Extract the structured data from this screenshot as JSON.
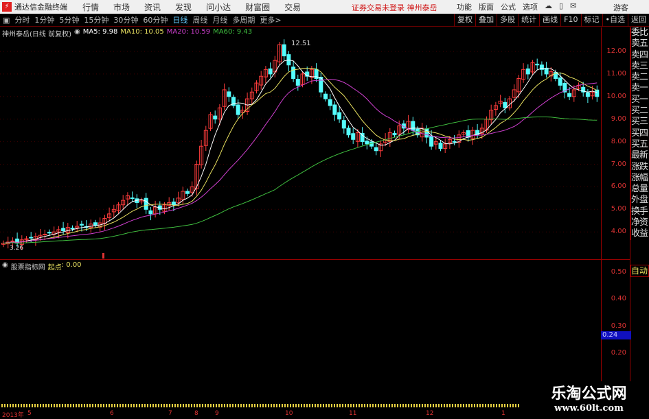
{
  "menubar": {
    "app_title": "通达信金融终端",
    "items": [
      "行情",
      "市场",
      "资讯",
      "发现",
      "问小达",
      "财富圈",
      "交易"
    ],
    "status": "证券交易未登录  神州泰岳",
    "right_items": [
      "功能",
      "版面",
      "公式",
      "选项"
    ],
    "guest": "游客"
  },
  "toolbar": {
    "periods": [
      "分时",
      "1分钟",
      "5分钟",
      "15分钟",
      "30分钟",
      "60分钟",
      "日线",
      "周线",
      "月线",
      "多周期",
      "更多>"
    ],
    "active": "日线",
    "right_buttons": [
      "复权",
      "叠加",
      "多股",
      "统计",
      "画线",
      "F10",
      "标记",
      "•自选",
      "返回"
    ]
  },
  "chart_info": {
    "title": "神州泰岳(日线 前复权)",
    "ma5": "MA5: 9.98",
    "ma10": "MA10: 10.05",
    "ma20": "MA20: 10.59",
    "ma60": "MA60: 9.43",
    "high_label": "12.51",
    "low_label": "3.26"
  },
  "colors": {
    "up": "#ff3c3c",
    "down": "#54fcfc",
    "ma5": "#ffffff",
    "ma10": "#e8e060",
    "ma20": "#d040d0",
    "ma60": "#40c040",
    "axis": "#d33333"
  },
  "price_axis": [
    "12.00",
    "11.00",
    "10.00",
    "9.00",
    "8.00",
    "7.00",
    "6.00",
    "5.00",
    "4.00"
  ],
  "side_panel": [
    "委比",
    "卖五",
    "卖四",
    "卖三",
    "卖二",
    "卖一",
    "买一",
    "买二",
    "买三",
    "买四",
    "买五",
    "最新",
    "涨跌",
    "涨幅",
    "总量",
    "外盘",
    "换手",
    "净资",
    "收益"
  ],
  "indicator": {
    "name": "股票指标网",
    "label": "起点",
    "value": ": 0.00",
    "auto": "自动",
    "axis": [
      "0.50",
      "0.40",
      "0.30",
      "0.20"
    ],
    "current": "0.24"
  },
  "dates": [
    "2013年",
    "5",
    "6",
    "7",
    "8",
    "9",
    "10",
    "11",
    "12",
    "1"
  ],
  "watermark": {
    "line1": "乐淘公式网",
    "line2": "www.60lt.com"
  },
  "chart_data": {
    "type": "candlestick",
    "ylim": [
      3,
      12.8
    ],
    "closes": [
      3.5,
      3.55,
      3.6,
      3.5,
      3.65,
      3.7,
      3.75,
      3.8,
      3.85,
      3.9,
      3.95,
      4.0,
      4.1,
      4.05,
      4.2,
      4.15,
      4.25,
      4.3,
      4.2,
      4.35,
      4.3,
      4.4,
      4.6,
      4.8,
      5.0,
      5.2,
      5.4,
      5.6,
      5.5,
      5.3,
      5.4,
      5.0,
      4.8,
      5.1,
      5.0,
      5.2,
      5.3,
      5.2,
      5.5,
      5.8,
      5.7,
      6.0,
      7.0,
      7.8,
      8.5,
      9.2,
      9.0,
      9.5,
      10.3,
      10.0,
      9.6,
      9.2,
      9.4,
      9.9,
      10.2,
      10.6,
      10.9,
      11.2,
      11.0,
      11.6,
      12.3,
      11.8,
      11.4,
      10.8,
      10.5,
      11.0,
      10.9,
      11.2,
      10.8,
      10.2,
      9.9,
      9.6,
      9.2,
      9.0,
      8.6,
      8.3,
      8.1,
      8.4,
      8.0,
      7.9,
      7.8,
      7.6,
      7.9,
      8.1,
      8.4,
      8.3,
      8.7,
      8.6,
      8.9,
      8.5,
      8.3,
      8.6,
      8.2,
      7.8,
      8.0,
      7.7,
      7.9,
      8.1,
      8.0,
      8.3,
      8.4,
      8.2,
      8.5,
      8.3,
      8.6,
      9.0,
      9.4,
      9.6,
      9.8,
      9.5,
      9.9,
      10.3,
      10.8,
      11.2,
      11.0,
      11.5,
      11.4,
      11.2,
      11.0,
      11.1,
      10.8,
      10.5,
      10.2,
      10.0,
      10.3,
      10.5,
      10.2,
      10.0,
      10.2,
      10.0
    ]
  }
}
